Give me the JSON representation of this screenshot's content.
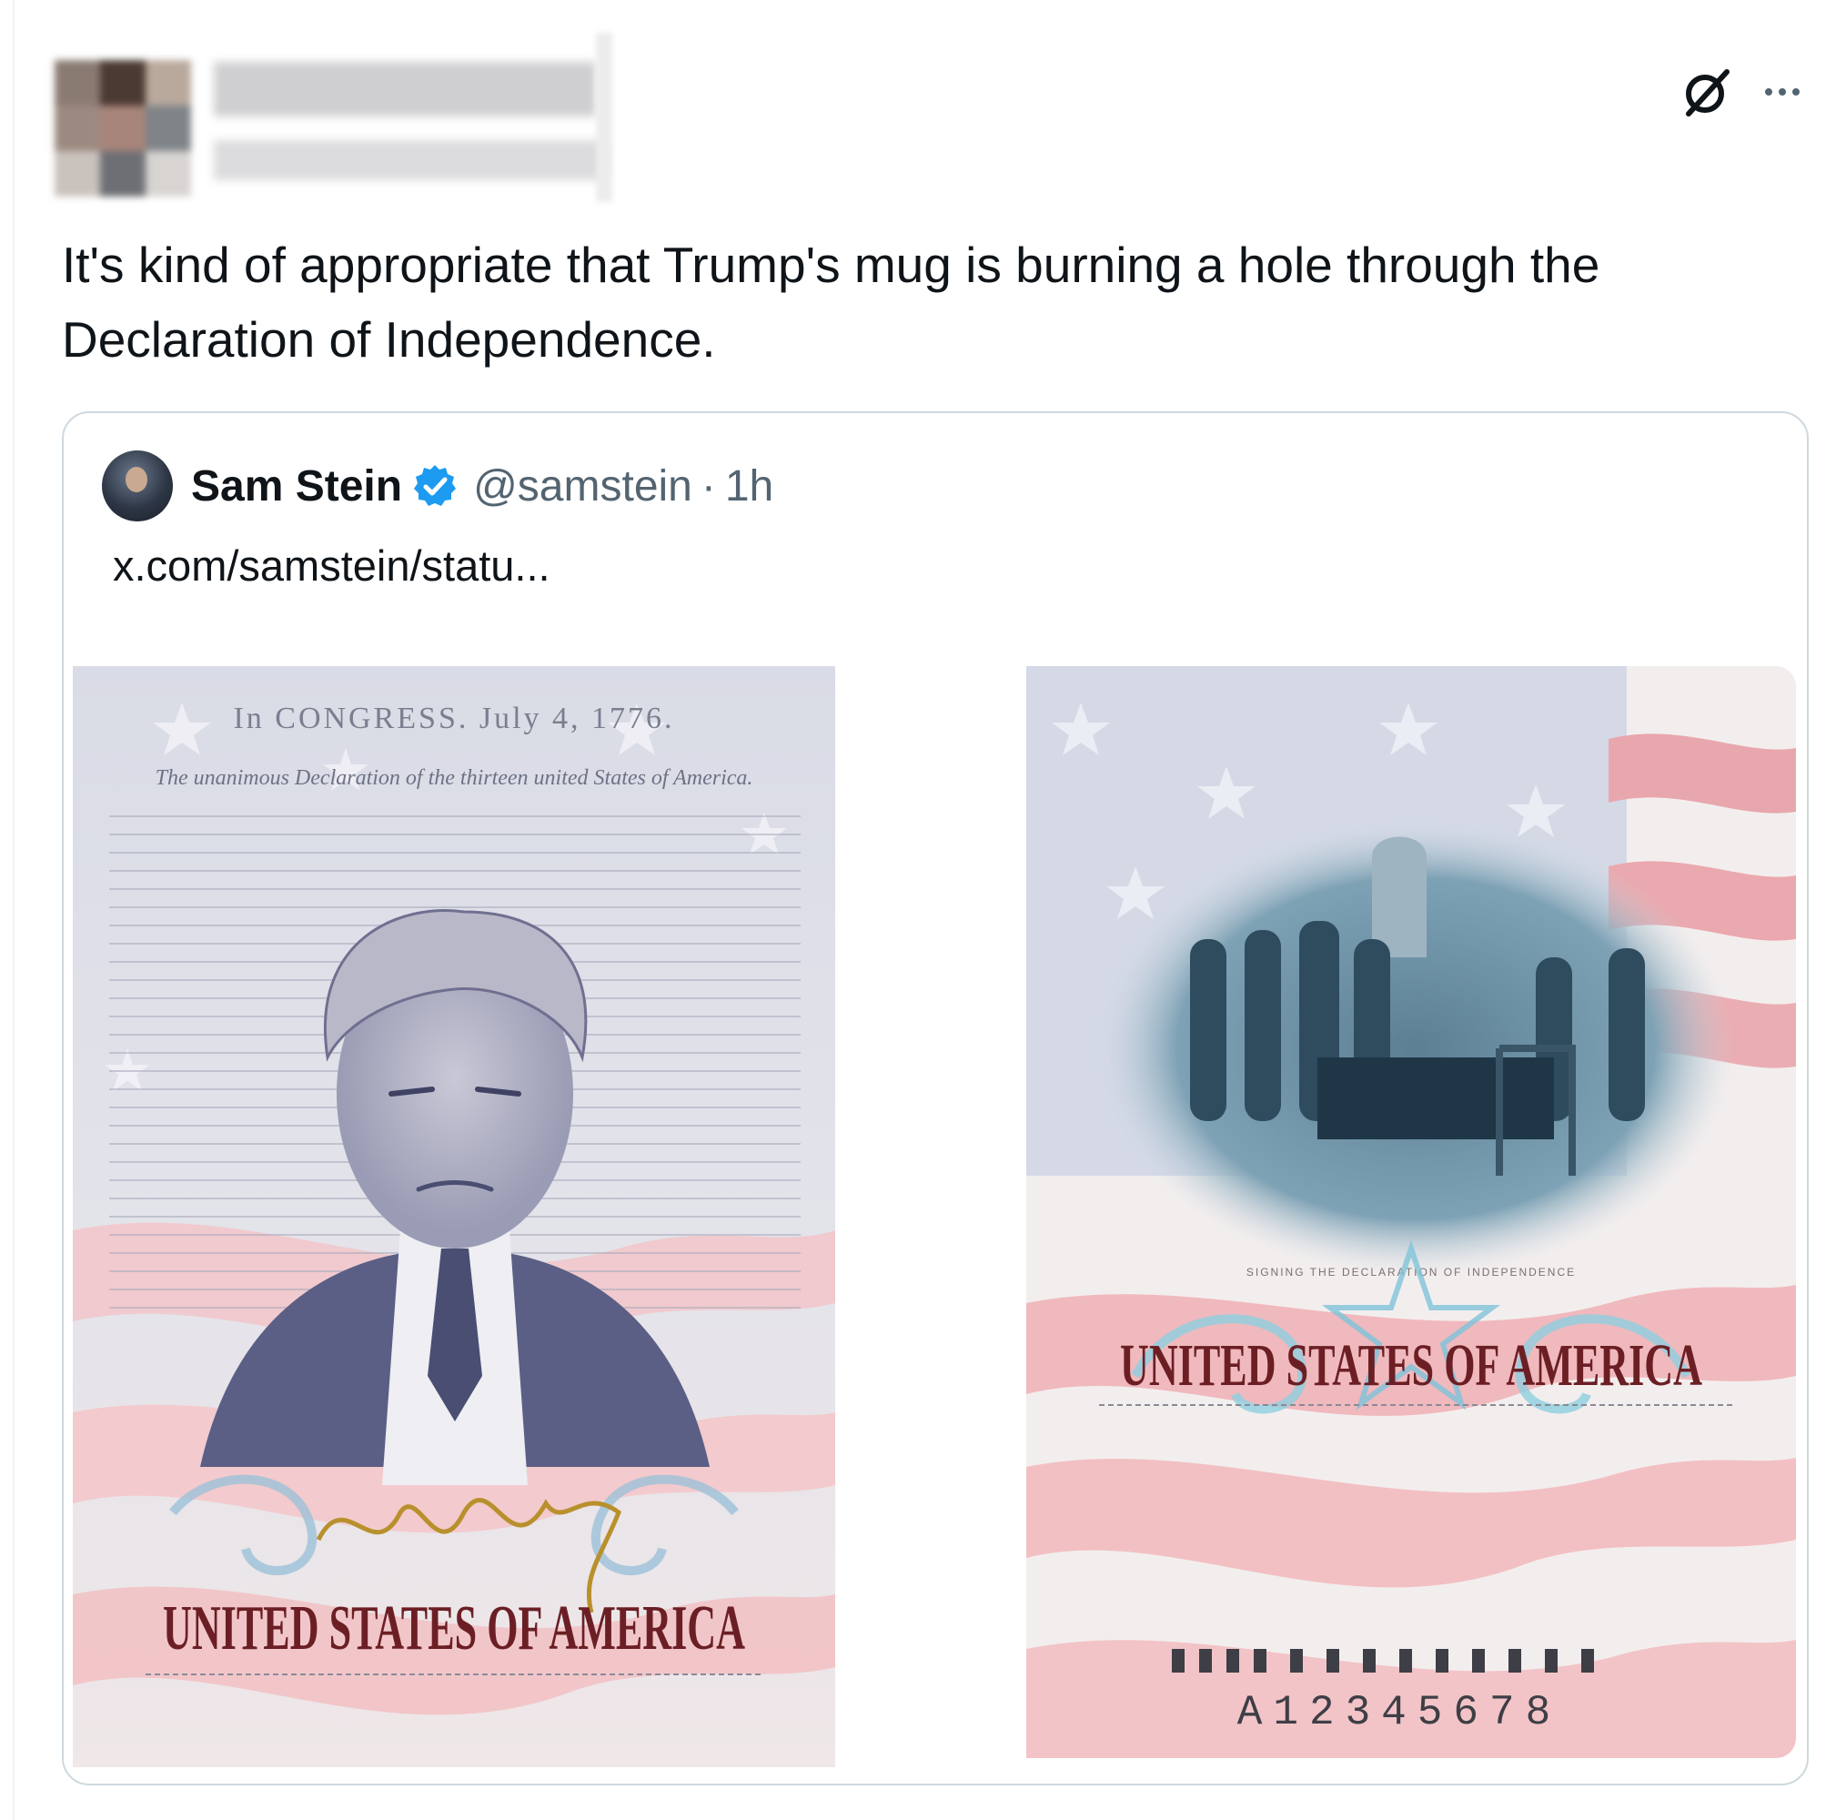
{
  "tweet": {
    "text": "It's kind of appropriate that Trump's mug is burning a hole through the Declaration of Independence.",
    "icons": [
      "grok-icon",
      "more-icon"
    ]
  },
  "quote": {
    "author_name": "Sam Stein",
    "verified": true,
    "handle": "@samstein",
    "separator": "·",
    "time": "1h",
    "link_text": "x.com/samstein/statu..."
  },
  "images": {
    "left": {
      "header": "In CONGRESS. July 4, 1776.",
      "subheader": "The unanimous Declaration of the thirteen united States of America.",
      "title": "UNITED STATES OF AMERICA"
    },
    "right": {
      "caption": "SIGNING THE DECLARATION OF INDEPENDENCE",
      "title": "UNITED STATES OF AMERICA",
      "number": "A12345678"
    }
  },
  "colors": {
    "text": "#0f1419",
    "secondary": "#536471",
    "border": "#cfd9de",
    "verified": "#1d9bf0",
    "title_red": "#6b1f24"
  }
}
